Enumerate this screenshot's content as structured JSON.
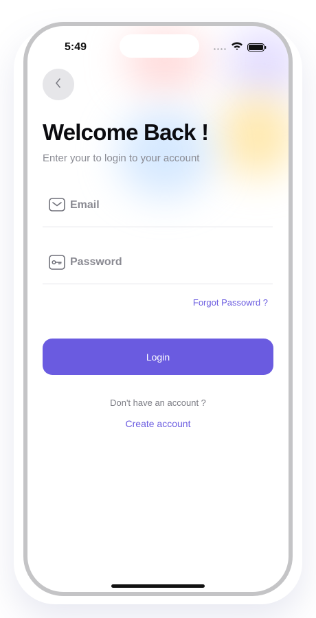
{
  "status_bar": {
    "time": "5:49",
    "icons": [
      "cellular-signal-icon",
      "wifi-icon",
      "battery-icon"
    ]
  },
  "back_button": {
    "icon": "chevron-left-icon"
  },
  "header": {
    "title": "Welcome Back !",
    "subtitle": "Enter your to login to your account"
  },
  "form": {
    "email": {
      "placeholder": "Email",
      "value": "",
      "icon": "mail-icon"
    },
    "password": {
      "placeholder": "Password",
      "value": "",
      "icon": "key-icon"
    },
    "forgot_label": "Forgot Passowrd ?",
    "login_label": "Login"
  },
  "footer": {
    "prompt": "Don't have an account ?",
    "create_label": "Create account"
  },
  "colors": {
    "accent": "#6a5be0",
    "title": "#0b0b0f",
    "muted": "#8a8b93",
    "back_button_bg": "#e6e6e9"
  }
}
